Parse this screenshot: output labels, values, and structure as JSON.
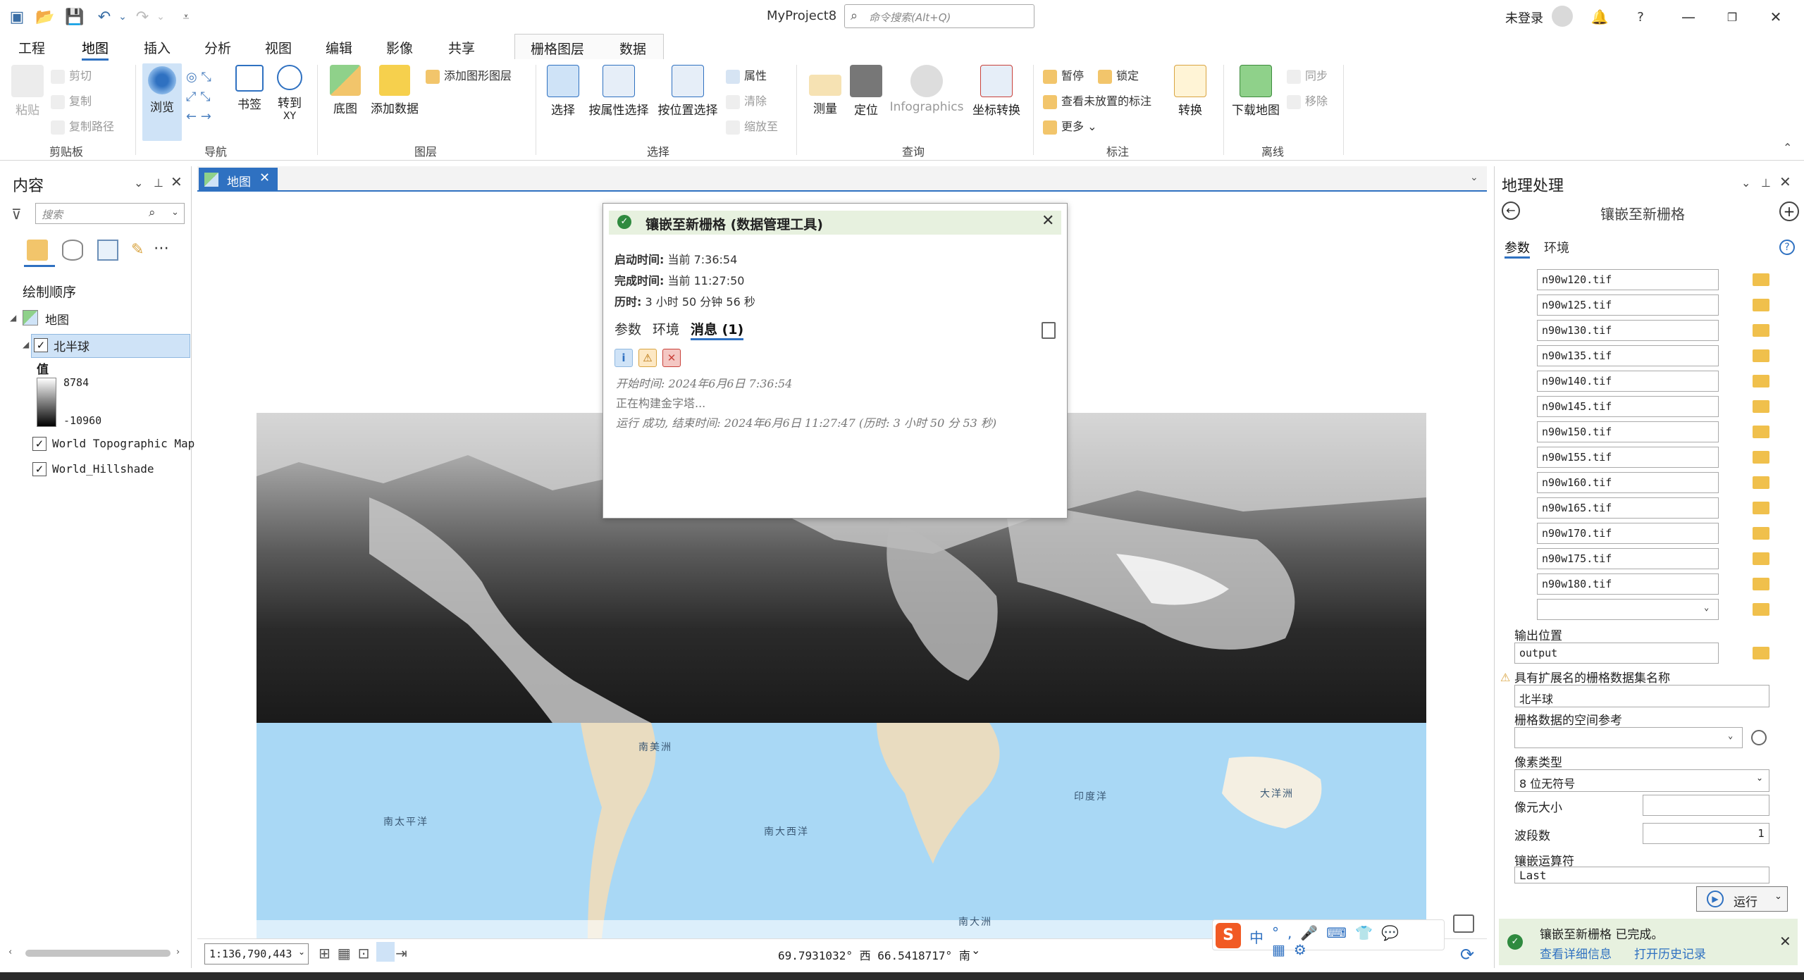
{
  "title_bar": {
    "app_title": "MyProject8",
    "search_placeholder": "命令搜索(Alt+Q)",
    "login_text": "未登录",
    "help": "?"
  },
  "tabs": [
    "工程",
    "地图",
    "插入",
    "分析",
    "视图",
    "编辑",
    "影像",
    "共享"
  ],
  "context_tabs": [
    "栅格图层",
    "数据"
  ],
  "ribbon": {
    "clipboard": {
      "paste": "粘贴",
      "cut": "剪切",
      "copy": "复制",
      "copy_path": "复制路径",
      "label": "剪贴板"
    },
    "navigate": {
      "explore": "浏览",
      "bookmarks": "书签",
      "goto_xy": "转到\nXY",
      "goto_a": "转到",
      "goto_b": "XY",
      "label": "导航"
    },
    "layer": {
      "basemap": "底图",
      "add_data": "添加数据",
      "add_graphics": "添加图形图层",
      "label": "图层"
    },
    "selection": {
      "select": "选择",
      "select_by_attr": "按属性选择",
      "select_by_loc": "按位置选择",
      "attributes": "属性",
      "clear": "清除",
      "zoom_to": "缩放至",
      "label": "选择"
    },
    "inquiry": {
      "measure": "测量",
      "locate": "定位",
      "infographics": "Infographics",
      "coord_convert": "坐标转换",
      "label": "查询"
    },
    "labeling": {
      "pause": "暂停",
      "lock": "锁定",
      "view_unplaced": "查看未放置的标注",
      "more": "更多",
      "convert": "转换",
      "label": "标注"
    },
    "offline": {
      "download_map": "下载地图",
      "sync": "同步",
      "remove": "移除",
      "label": "离线"
    }
  },
  "contents": {
    "title": "内容",
    "search_placeholder": "搜索",
    "drawing_order": "绘制顺序",
    "map_name": "地图",
    "layer_selected": "北半球",
    "value_label": "值",
    "value_max": "8784",
    "value_min": "-10960",
    "layers": [
      "World Topographic Map",
      "World_Hillshade"
    ]
  },
  "map": {
    "tab": "地图",
    "scale": "1:136,790,443",
    "coords": "69.7931032° 西 66.5418717° 南",
    "labels": {
      "south_america": "南美洲",
      "south_pacific": "南太平洋",
      "south_atlantic": "南大西洋",
      "indian_ocean": "印度洋",
      "oceania": "大洋洲",
      "antarctica": "南大洲"
    }
  },
  "dialog": {
    "title": "镶嵌至新栅格 (数据管理工具)",
    "start_label": "启动时间:",
    "start_value": "当前 7:36:54",
    "end_label": "完成时间:",
    "end_value": "当前 11:27:50",
    "elapsed_label": "历时:",
    "elapsed_value": "3 小时 50 分钟 56 秒",
    "tabs": [
      "参数",
      "环境",
      "消息 (1)"
    ],
    "messages": [
      "开始时间: 2024年6月6日 7:36:54",
      "正在构建金字塔...",
      "运行 成功, 结束时间: 2024年6月6日 11:27:47 (历时: 3 小时 50 分 53 秒)"
    ]
  },
  "gp": {
    "title": "地理处理",
    "tool_name": "镶嵌至新栅格",
    "tabs": [
      "参数",
      "环境"
    ],
    "inputs": [
      "n90w120.tif",
      "n90w125.tif",
      "n90w130.tif",
      "n90w135.tif",
      "n90w140.tif",
      "n90w145.tif",
      "n90w150.tif",
      "n90w155.tif",
      "n90w160.tif",
      "n90w165.tif",
      "n90w170.tif",
      "n90w175.tif",
      "n90w180.tif"
    ],
    "output_location_label": "输出位置",
    "output_location": "output",
    "dataset_name_label": "具有扩展名的栅格数据集名称",
    "dataset_name": "北半球",
    "spatial_ref_label": "栅格数据的空间参考",
    "pixel_type_label": "像素类型",
    "pixel_type": "8 位无符号",
    "cellsize_label": "像元大小",
    "bands_label": "波段数",
    "bands_value": "1",
    "mosaic_op_label": "镶嵌运算符",
    "mosaic_op": "Last",
    "run": "运行",
    "done_text": "镶嵌至新栅格 已完成。",
    "view_details": "查看详细信息",
    "open_history": "打开历史记录"
  },
  "ime": {
    "lang": "中"
  }
}
